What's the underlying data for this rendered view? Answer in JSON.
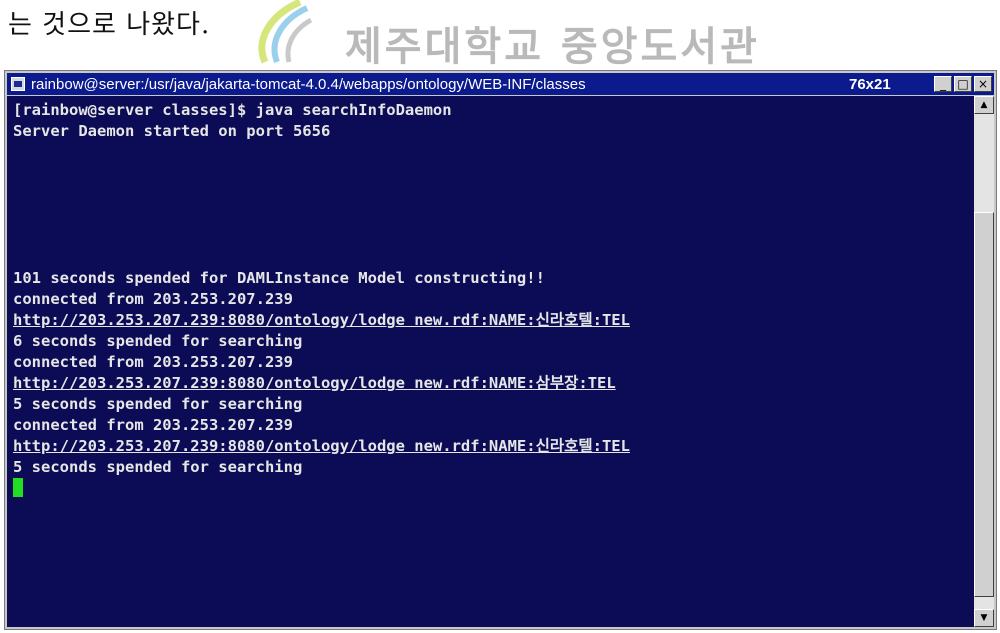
{
  "document": {
    "text": "는 것으로 나왔다."
  },
  "watermark": {
    "text": "제주대학교 중앙도서관",
    "color": "#b9b9b9"
  },
  "window": {
    "title": "rainbow@server:/usr/java/jakarta-tomcat-4.0.4/webapps/ontology/WEB-INF/classes",
    "size": "76x21",
    "buttons": {
      "minimize": "_",
      "maximize": "□",
      "close": "×"
    },
    "titlebar_color": "#0b1a8c",
    "background_color": "#0b0c55",
    "text_color": "#e6e6e6",
    "cursor_color": "#22dd22"
  },
  "terminal": {
    "lines": [
      "[rainbow@server classes]$ java searchInfoDaemon",
      "Server Daemon started on port 5656",
      "",
      "",
      "",
      "",
      "",
      "",
      "101 seconds spended for DAMLInstance Model constructing!!",
      "connected from 203.253.207.239",
      "http://203.253.207.239:8080/ontology/lodge new.rdf:NAME:신라호텔:TEL",
      "6 seconds spended for searching",
      "connected from 203.253.207.239",
      "http://203.253.207.239:8080/ontology/lodge new.rdf:NAME:삼부장:TEL",
      "5 seconds spended for searching",
      "connected from 203.253.207.239",
      "http://203.253.207.239:8080/ontology/lodge new.rdf:NAME:신라호텔:TEL",
      "5 seconds spended for searching"
    ]
  },
  "scrollbar": {
    "up_arrow": "▲",
    "down_arrow": "▼"
  }
}
